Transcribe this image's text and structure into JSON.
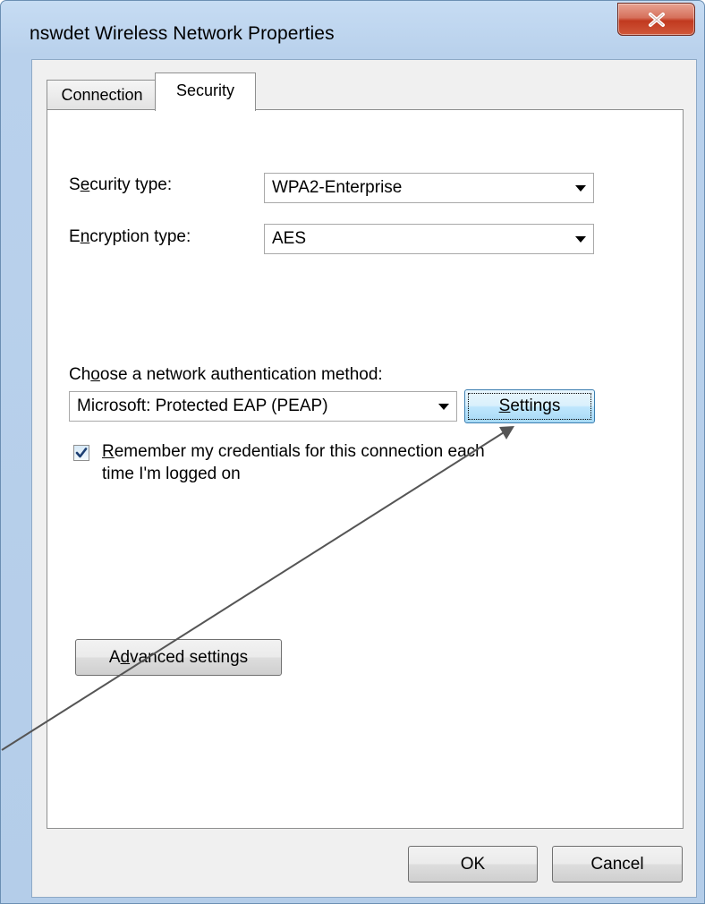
{
  "window": {
    "title": "nswdet Wireless Network Properties",
    "close_glyph": "x"
  },
  "tabs": [
    {
      "label": "Connection",
      "selected": false
    },
    {
      "label": "Security",
      "selected": true
    }
  ],
  "security": {
    "security_type_label_pre": "S",
    "security_type_label_key": "e",
    "security_type_label_post": "curity type:",
    "security_type_value": "WPA2-Enterprise",
    "encryption_type_label_pre": "E",
    "encryption_type_label_key": "n",
    "encryption_type_label_post": "cryption type:",
    "encryption_type_value": "AES"
  },
  "auth": {
    "label_pre": "Ch",
    "label_key": "o",
    "label_post": "ose a network authentication method:",
    "method_value": "Microsoft: Protected EAP (PEAP)",
    "settings_key": "S",
    "settings_rest": "ettings",
    "remember_checked": true,
    "remember_key": "R",
    "remember_line1_rest": "emember my credentials for this connection each",
    "remember_line2": "time I'm logged on"
  },
  "advanced": {
    "label_pre": "A",
    "label_key": "d",
    "label_post": "vanced settings"
  },
  "footer": {
    "ok_label": "OK",
    "cancel_label": "Cancel"
  },
  "colors": {
    "frame": "#b9d1ec",
    "close_button": "#c1391f",
    "arrow_annotation": "#555555"
  }
}
